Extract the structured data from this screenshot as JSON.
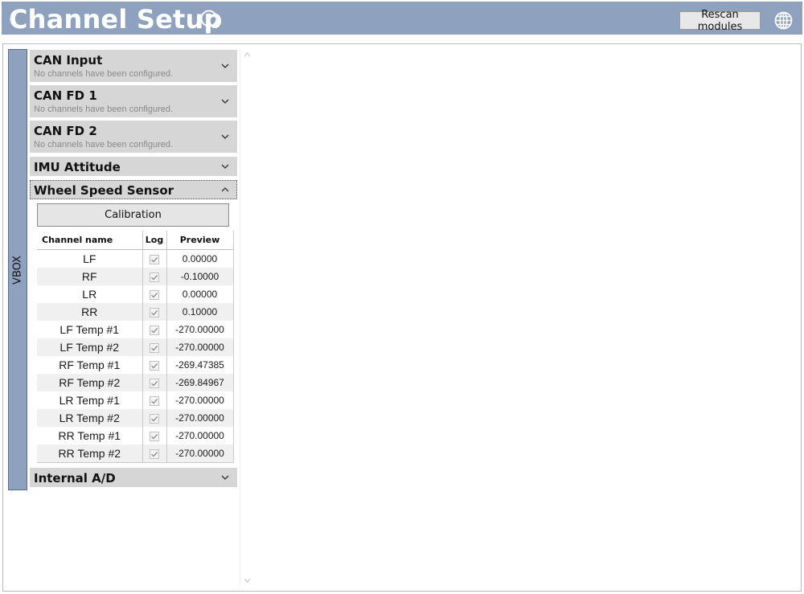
{
  "header": {
    "title": "Channel Setup",
    "rescan_label": "Rescan modules",
    "background_color": "#8ea1be",
    "help_icon": "question-circle-icon",
    "globe_icon": "globe-icon"
  },
  "side_tab": {
    "label": "VBOX"
  },
  "sections": [
    {
      "title": "CAN Input",
      "subtitle": "No channels have been configured.",
      "expanded": false
    },
    {
      "title": "CAN FD 1",
      "subtitle": "No channels have been configured.",
      "expanded": false
    },
    {
      "title": "CAN FD 2",
      "subtitle": "No channels have been configured.",
      "expanded": false
    },
    {
      "title": "IMU Attitude",
      "expanded": false
    },
    {
      "title": "Wheel Speed Sensor",
      "expanded": true
    },
    {
      "title": "Internal A/D",
      "expanded": false
    }
  ],
  "wheel_speed": {
    "calibration_label": "Calibration",
    "columns": [
      "Channel name",
      "Log",
      "Preview"
    ],
    "rows": [
      {
        "name": "LF",
        "log": true,
        "preview": "0.00000"
      },
      {
        "name": "RF",
        "log": true,
        "preview": "-0.10000"
      },
      {
        "name": "LR",
        "log": true,
        "preview": "0.00000"
      },
      {
        "name": "RR",
        "log": true,
        "preview": "0.10000"
      },
      {
        "name": "LF Temp #1",
        "log": true,
        "preview": "-270.00000"
      },
      {
        "name": "LF Temp #2",
        "log": true,
        "preview": "-270.00000"
      },
      {
        "name": "RF Temp #1",
        "log": true,
        "preview": "-269.47385"
      },
      {
        "name": "RF Temp #2",
        "log": true,
        "preview": "-269.84967"
      },
      {
        "name": "LR Temp #1",
        "log": true,
        "preview": "-270.00000"
      },
      {
        "name": "LR Temp #2",
        "log": true,
        "preview": "-270.00000"
      },
      {
        "name": "RR Temp #1",
        "log": true,
        "preview": "-270.00000"
      },
      {
        "name": "RR Temp #2",
        "log": true,
        "preview": "-270.00000"
      }
    ]
  }
}
